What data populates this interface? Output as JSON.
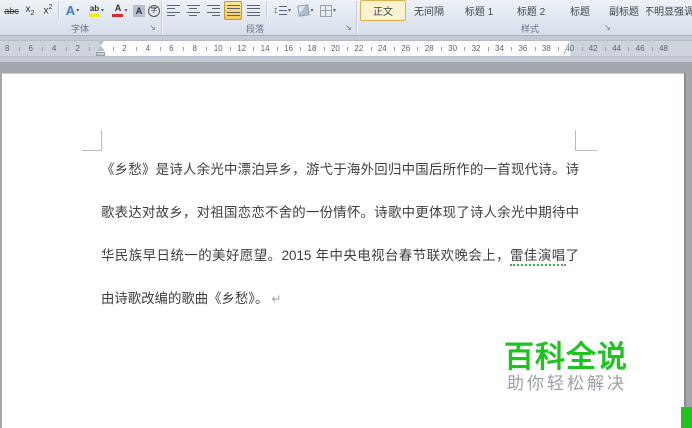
{
  "icons": {
    "dropdown": "▾",
    "launcher": "↘",
    "line_spacing": "↕"
  },
  "ribbon": {
    "font_group": {
      "label": "字体",
      "strikethrough": "abc",
      "sub_base": "x",
      "sub_mark": "2",
      "sup_base": "x",
      "sup_mark": "2",
      "text_effects": "A",
      "highlight_glyph": "ab",
      "font_color_glyph": "A",
      "char_shading_glyph": "A",
      "enclose_glyph": "字"
    },
    "paragraph_group": {
      "label": "段落"
    },
    "styles_group": {
      "label": "样式",
      "items": [
        {
          "label": "正文",
          "selected": true
        },
        {
          "label": "无间隔",
          "selected": false
        },
        {
          "label": "标题 1",
          "selected": false
        },
        {
          "label": "标题 2",
          "selected": false
        },
        {
          "label": "标题",
          "selected": false
        },
        {
          "label": "副标题",
          "selected": false
        },
        {
          "label": "不明显强调",
          "selected": false
        }
      ]
    }
  },
  "ruler": {
    "left_numbers": [
      8,
      6,
      4,
      2
    ],
    "right_numbers": [
      2,
      4,
      6,
      8,
      10,
      12,
      14,
      16,
      18,
      20,
      22,
      24,
      26,
      28,
      30,
      32,
      34,
      36,
      38,
      40,
      42,
      44,
      46,
      48
    ]
  },
  "document": {
    "line1": "《乡愁》是诗人余光中漂泊异乡，游弋于海外回归中国后所作的一首现代诗。诗",
    "line2": "歌表达对故乡，对祖国恋恋不舍的一份情怀。诗歌中更体现了诗人余光中期待中",
    "line3_pre": "华民族早日统一的美好愿望。2015 年中央电视台春节联欢晚会上，",
    "line3_spellcheck": "雷佳演唱",
    "line3_post": "了",
    "line4": "由诗歌改编的歌曲《乡愁》。",
    "paragraph_mark": "↵"
  },
  "watermark": {
    "title": "百科全说",
    "subtitle": "助你轻松解决",
    "title_color": "#1ec41e",
    "subtitle_color": "#9ba1a6"
  },
  "colors": {
    "style_selected_bg": "#fdf3cf",
    "style_selected_border": "#e0b04f",
    "spellcheck_underline": "#3db54a"
  }
}
